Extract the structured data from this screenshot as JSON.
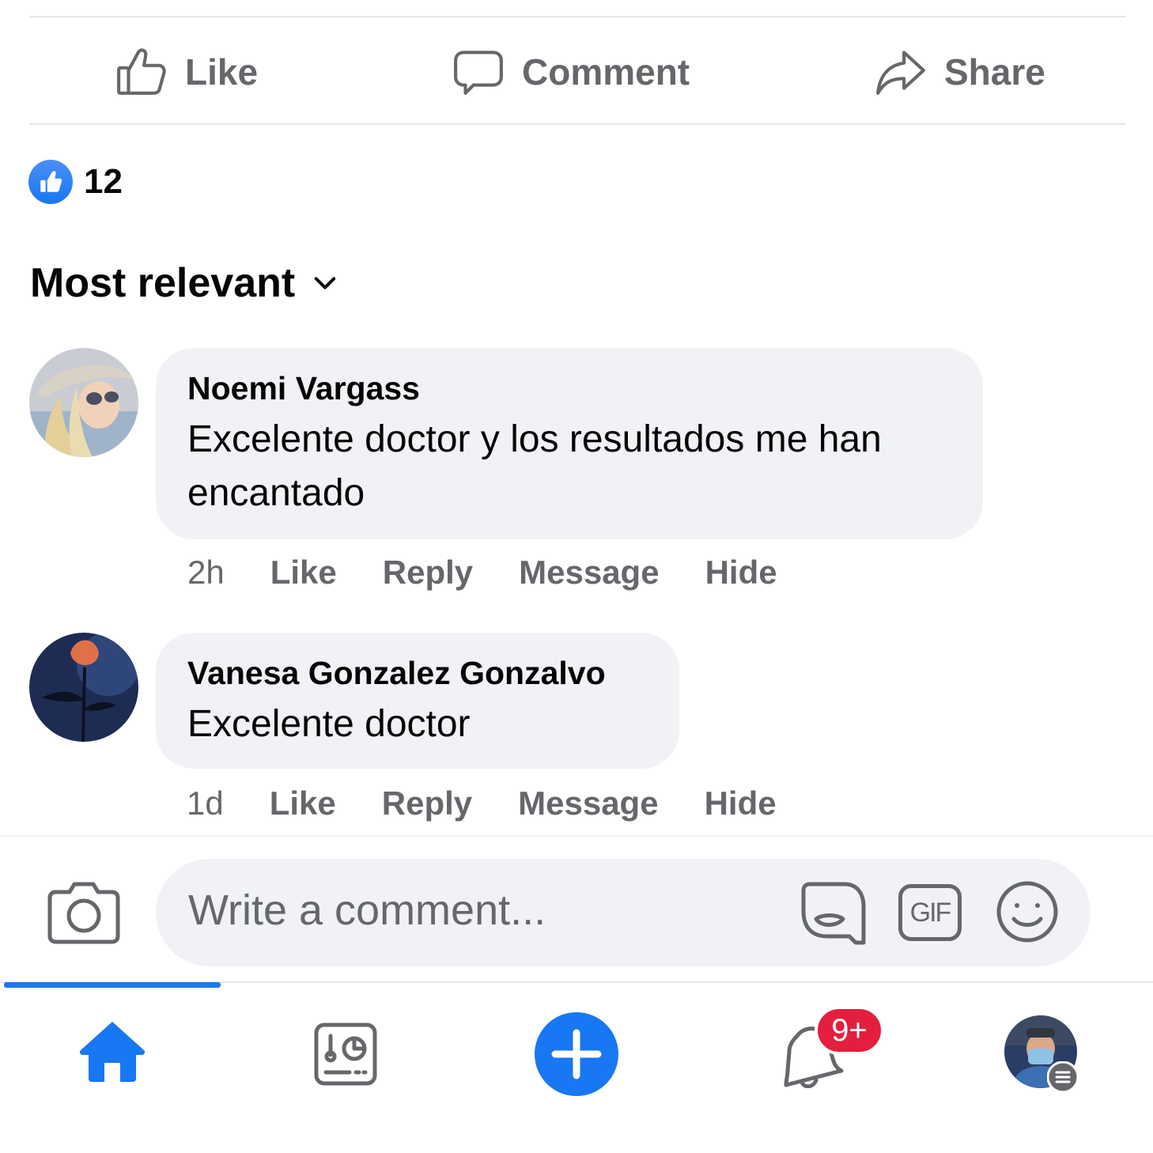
{
  "actions": {
    "like": "Like",
    "comment": "Comment",
    "share": "Share"
  },
  "reactions": {
    "count": "12",
    "icon": "like-reaction-icon"
  },
  "sort": {
    "label": "Most relevant"
  },
  "comments": [
    {
      "author": "Noemi Vargass",
      "text": "Excelente doctor y los resultados me han encantado",
      "time": "2h",
      "like": "Like",
      "reply": "Reply",
      "message": "Message",
      "hide": "Hide"
    },
    {
      "author": "Vanesa Gonzalez Gonzalvo",
      "text": "Excelente doctor",
      "time": "1d",
      "like": "Like",
      "reply": "Reply",
      "message": "Message",
      "hide": "Hide"
    }
  ],
  "composer": {
    "placeholder": "Write a comment...",
    "gif": "GIF"
  },
  "nav": {
    "badge": "9+",
    "active": "home"
  },
  "colors": {
    "accent": "#1877f2",
    "badge": "#e41e3f",
    "muted": "#65676b",
    "bubble": "#f0f2f5"
  }
}
